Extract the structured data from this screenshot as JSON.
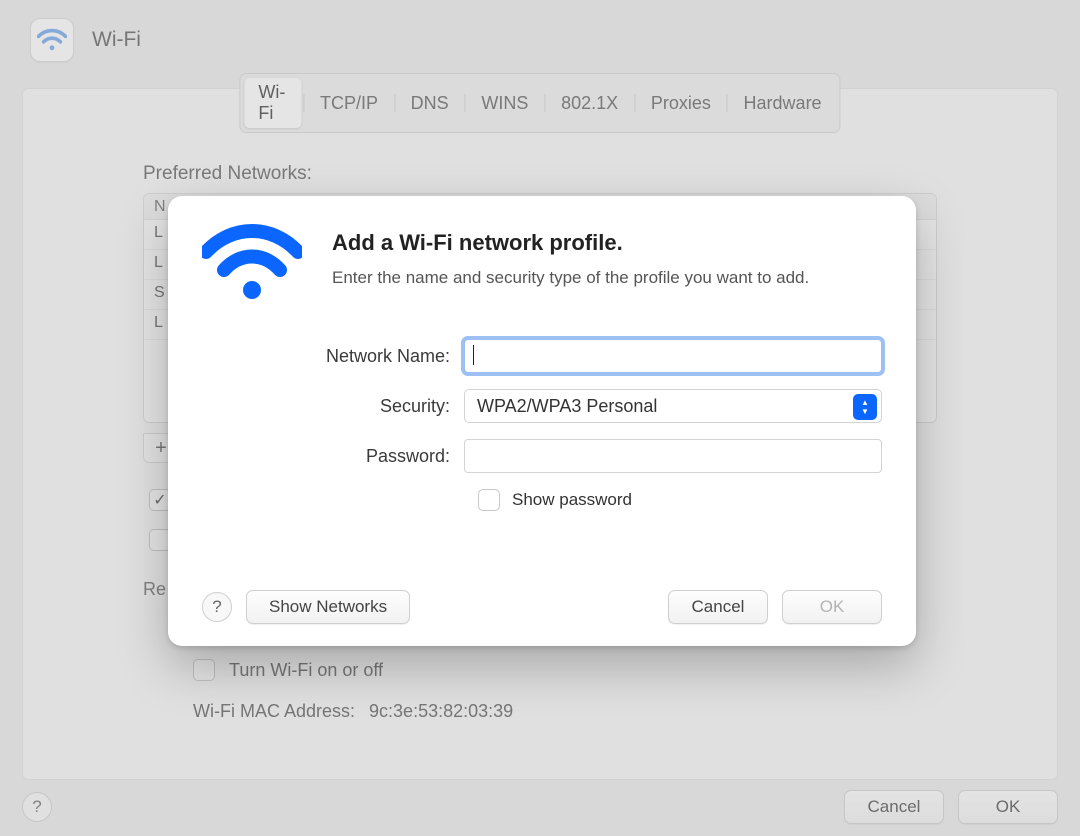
{
  "window": {
    "title": "Wi-Fi"
  },
  "tabs": [
    "Wi-Fi",
    "TCP/IP",
    "DNS",
    "WINS",
    "802.1X",
    "Proxies",
    "Hardware"
  ],
  "active_tab_index": 0,
  "preferred_networks": {
    "label": "Preferred Networks:",
    "header": "N",
    "rows": [
      "L",
      "L",
      "S",
      "L"
    ]
  },
  "add_button": "+",
  "bg_checkbox1_checked": true,
  "bg_checkbox2_checked": false,
  "re_label": "Re",
  "turn_wifi_label": "Turn Wi-Fi on or off",
  "turn_wifi_checked": false,
  "mac": {
    "label": "Wi-Fi MAC Address:",
    "value": "9c:3e:53:82:03:39"
  },
  "footer": {
    "cancel": "Cancel",
    "ok": "OK",
    "help": "?"
  },
  "modal": {
    "title": "Add a Wi-Fi network profile.",
    "subtitle": "Enter the name and security type of the profile you want to add.",
    "network_name_label": "Network Name:",
    "network_name_value": "",
    "security_label": "Security:",
    "security_value": "WPA2/WPA3 Personal",
    "password_label": "Password:",
    "password_value": "",
    "show_password_label": "Show password",
    "show_password_checked": false,
    "help": "?",
    "show_networks": "Show Networks",
    "cancel": "Cancel",
    "ok": "OK",
    "ok_enabled": false
  }
}
